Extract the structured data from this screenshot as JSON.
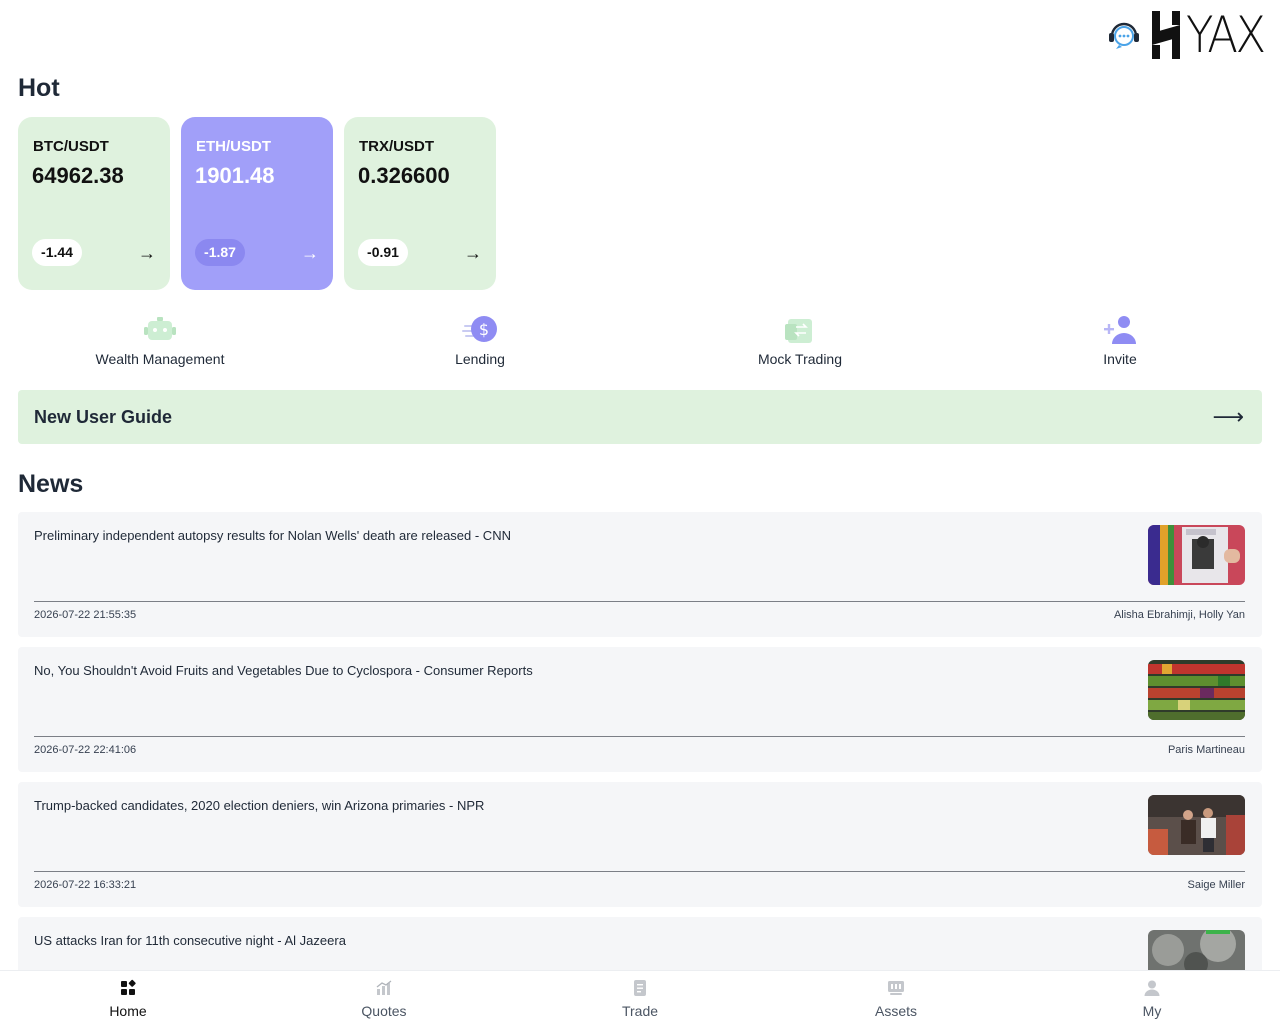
{
  "header": {
    "logo_text": "YAX",
    "support_icon": "headset-chat-icon"
  },
  "hot": {
    "title": "Hot",
    "cards": [
      {
        "pair": "BTC/USDT",
        "price": "64962.38",
        "change": "-1.44",
        "arrow": "→",
        "active": false
      },
      {
        "pair": "ETH/USDT",
        "price": "1901.48",
        "change": "-1.87",
        "arrow": "→",
        "active": true
      },
      {
        "pair": "TRX/USDT",
        "price": "0.326600",
        "change": "-0.91",
        "arrow": "→",
        "active": false
      }
    ]
  },
  "quick_entries": [
    {
      "label": "Wealth Management",
      "icon": "robot-icon"
    },
    {
      "label": "Lending",
      "icon": "dollar-coin-icon"
    },
    {
      "label": "Mock Trading",
      "icon": "swap-document-icon"
    },
    {
      "label": "Invite",
      "icon": "add-user-icon"
    }
  ],
  "guide": {
    "label": "New User Guide",
    "arrow": "⟶"
  },
  "news": {
    "title": "News",
    "items": [
      {
        "title": "Preliminary independent autopsy results for Nolan Wells' death are released - CNN",
        "date": "2026-07-22 21:55:35",
        "author": "Alisha Ebrahimji, Holly Yan",
        "thumb": "protest-photo"
      },
      {
        "title": "No, You Shouldn't Avoid Fruits and Vegetables Due to Cyclospora - Consumer Reports",
        "date": "2026-07-22 22:41:06",
        "author": "Paris Martineau",
        "thumb": "produce-photo"
      },
      {
        "title": "Trump-backed candidates, 2020 election deniers, win Arizona primaries - NPR",
        "date": "2026-07-22 16:33:21",
        "author": "Saige Miller",
        "thumb": "street-photo"
      },
      {
        "title": "US attacks Iran for 11th consecutive night - Al Jazeera",
        "date": "",
        "author": "",
        "thumb": "night-strike-photo"
      }
    ]
  },
  "tabbar": {
    "tabs": [
      {
        "label": "Home",
        "icon": "home-grid-icon",
        "active": true
      },
      {
        "label": "Quotes",
        "icon": "chart-icon",
        "active": false
      },
      {
        "label": "Trade",
        "icon": "trade-document-icon",
        "active": false
      },
      {
        "label": "Assets",
        "icon": "wallet-icon",
        "active": false
      },
      {
        "label": "My",
        "icon": "user-icon",
        "active": false
      }
    ]
  },
  "colors": {
    "card_bg": "#dff2de",
    "card_active_bg": "#a19ff9",
    "accent_purple": "#8b88f0",
    "news_bg": "#f5f6f8"
  }
}
